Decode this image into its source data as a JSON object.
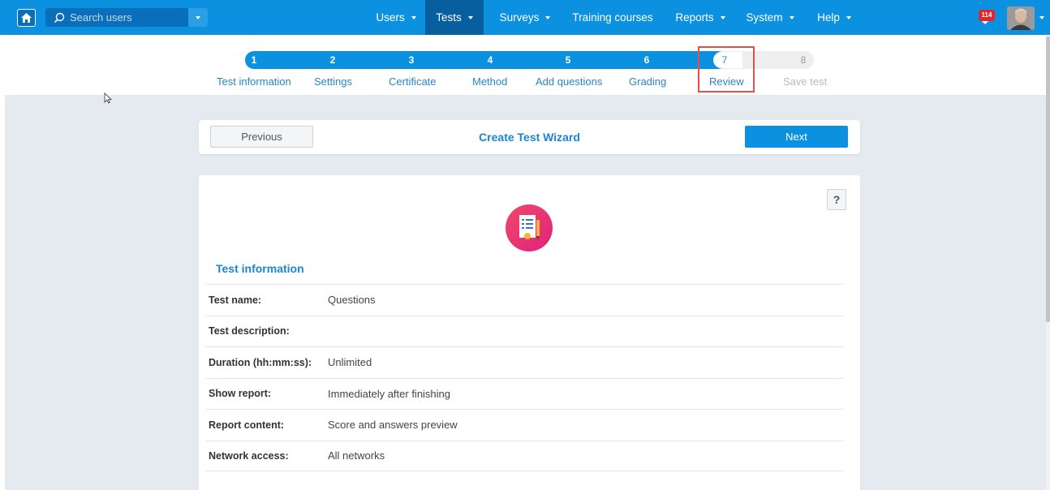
{
  "topbar": {
    "home_icon": "home-icon",
    "search_placeholder": "Search users",
    "nav_items": [
      {
        "label": "Users",
        "has_caret": true
      },
      {
        "label": "Tests",
        "has_caret": true,
        "active": true
      },
      {
        "label": "Surveys",
        "has_caret": true
      },
      {
        "label": "Training courses",
        "has_caret": false
      },
      {
        "label": "Reports",
        "has_caret": true
      },
      {
        "label": "System",
        "has_caret": true
      },
      {
        "label": "Help",
        "has_caret": true
      }
    ],
    "notification_count": "114",
    "accent_color": "#0b91e0"
  },
  "wizard_steps": [
    {
      "number": "1",
      "label": "Test information",
      "state": "done"
    },
    {
      "number": "2",
      "label": "Settings",
      "state": "done"
    },
    {
      "number": "3",
      "label": "Certificate",
      "state": "done"
    },
    {
      "number": "4",
      "label": "Method",
      "state": "done"
    },
    {
      "number": "5",
      "label": "Add questions",
      "state": "done"
    },
    {
      "number": "6",
      "label": "Grading",
      "state": "done"
    },
    {
      "number": "7",
      "label": "Review",
      "state": "current"
    },
    {
      "number": "8",
      "label": "Save test",
      "state": "disabled"
    }
  ],
  "wizard_bar": {
    "previous_label": "Previous",
    "title": "Create Test Wizard",
    "next_label": "Next"
  },
  "card": {
    "help_label": "?",
    "section_title": "Test information",
    "rows": [
      {
        "label": "Test name:",
        "value": "Questions"
      },
      {
        "label": "Test description:",
        "value": ""
      },
      {
        "label": "Duration (hh:mm:ss):",
        "value": "Unlimited"
      },
      {
        "label": "Show report:",
        "value": "Immediately after finishing"
      },
      {
        "label": "Report content:",
        "value": "Score and answers preview"
      },
      {
        "label": "Network access:",
        "value": "All networks"
      }
    ]
  }
}
